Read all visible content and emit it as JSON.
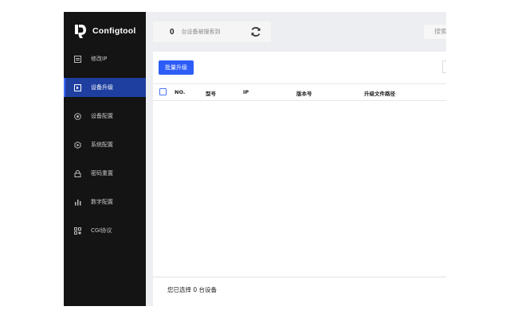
{
  "app": {
    "title": "Configtool"
  },
  "sidebar": {
    "items": [
      {
        "label": "修改IP",
        "icon": "ip-edit-icon"
      },
      {
        "label": "设备升级",
        "icon": "device-upgrade-icon",
        "active": true
      },
      {
        "label": "设备配置",
        "icon": "device-config-icon"
      },
      {
        "label": "系统配置",
        "icon": "system-config-icon"
      },
      {
        "label": "密码重置",
        "icon": "password-reset-icon"
      },
      {
        "label": "数字配置",
        "icon": "digital-config-icon"
      },
      {
        "label": "CGI协议",
        "icon": "cgi-protocol-icon"
      }
    ]
  },
  "topbar": {
    "count": "0",
    "count_text": "台设备被搜索到",
    "refresh_icon": "refresh-icon"
  },
  "search": {
    "label": "搜索"
  },
  "toolbar": {
    "batch_upgrade_label": "批量升级"
  },
  "table": {
    "columns": [
      "NO.",
      "型号",
      "IP",
      "版本号",
      "升级文件路径"
    ],
    "rows": []
  },
  "footer": {
    "selected_text": "您已选择 0 台设备"
  },
  "colors": {
    "sidebar_bg": "#141414",
    "active_bg": "#1f3fa0",
    "accent": "#2d5cf6"
  }
}
